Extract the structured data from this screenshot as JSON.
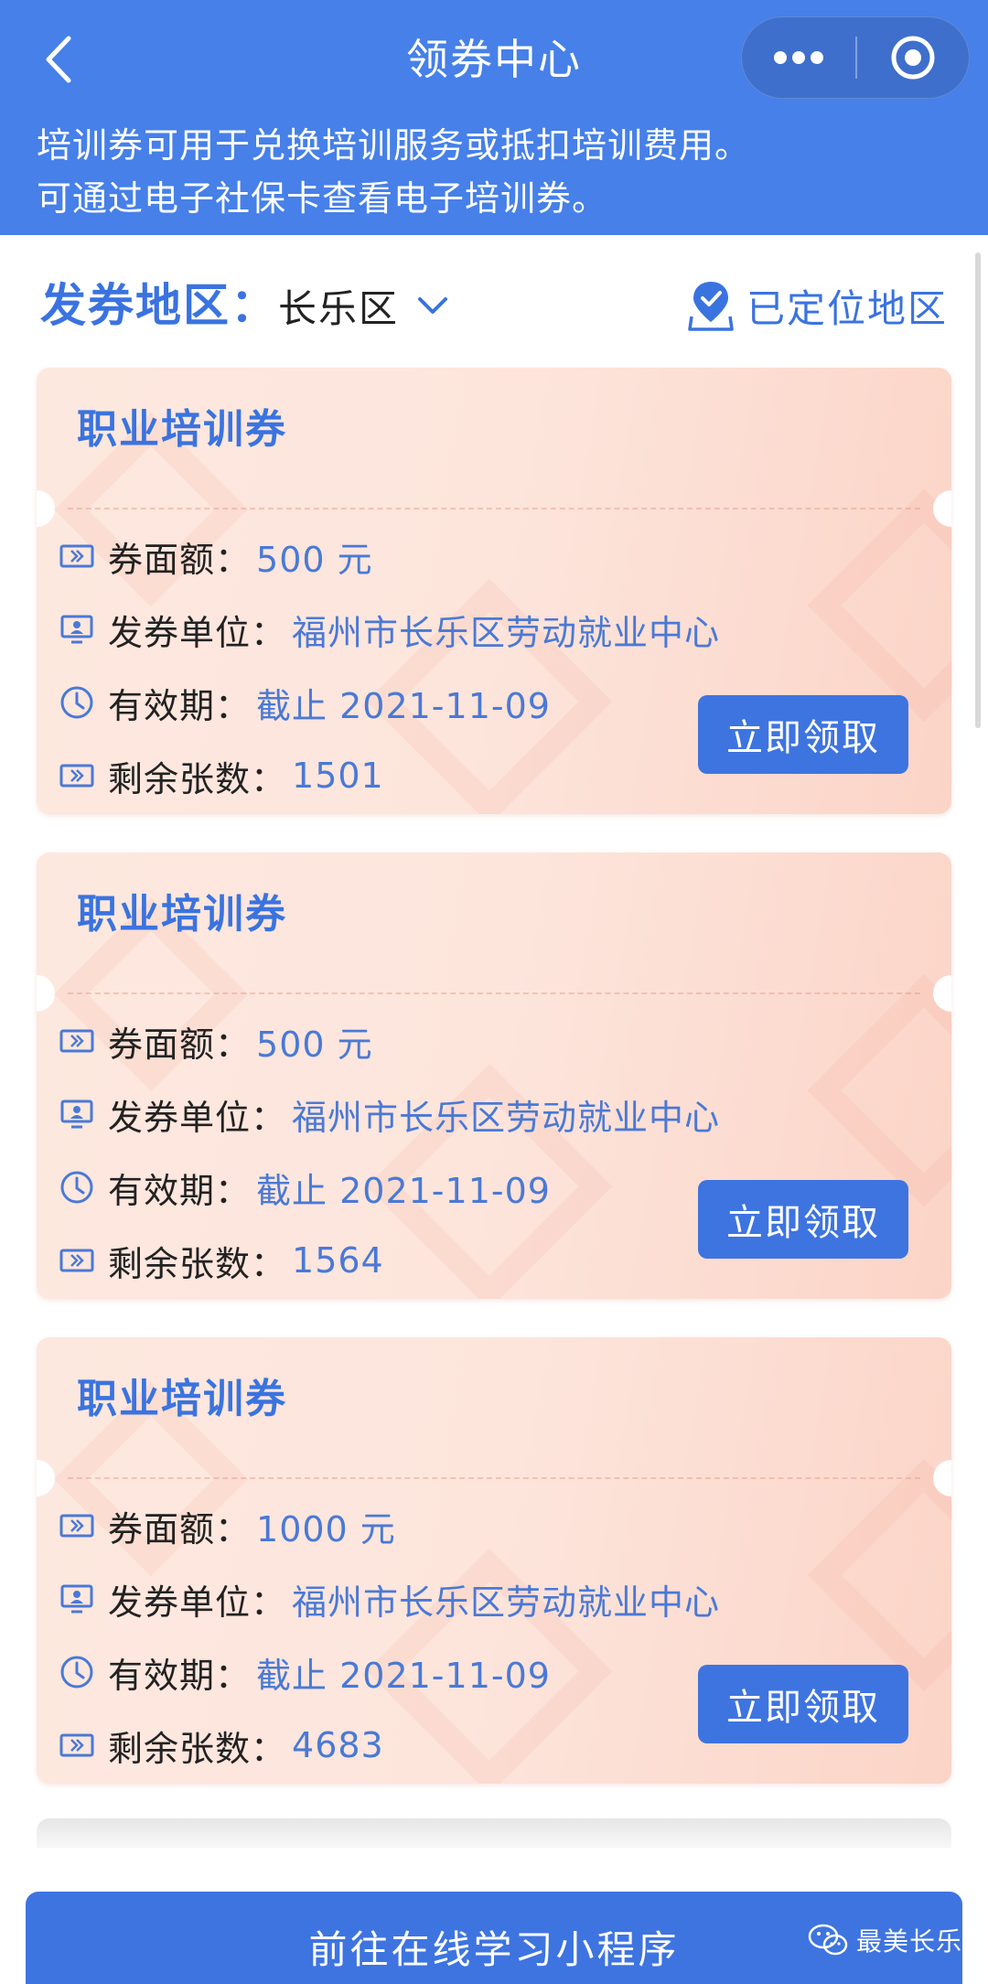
{
  "header": {
    "title": "领券中心",
    "intro_line1": "培训券可用于兑换培训服务或抵扣培训费用。",
    "intro_line2": "可通过电子社保卡查看电子培训券。"
  },
  "region": {
    "label": "发券地区：",
    "selected": "长乐区",
    "located_text": "已定位地区"
  },
  "coupon_fields": {
    "amount_label": "券面额：",
    "issuer_label": "发券单位：",
    "validity_label": "有效期：",
    "remaining_label": "剩余张数："
  },
  "coupons": [
    {
      "title": "职业培训券",
      "amount": "500 元",
      "issuer": "福州市长乐区劳动就业中心",
      "validity": "截止 2021-11-09",
      "remaining": "1501",
      "button": "立即领取"
    },
    {
      "title": "职业培训券",
      "amount": "500 元",
      "issuer": "福州市长乐区劳动就业中心",
      "validity": "截止 2021-11-09",
      "remaining": "1564",
      "button": "立即领取"
    },
    {
      "title": "职业培训券",
      "amount": "1000 元",
      "issuer": "福州市长乐区劳动就业中心",
      "validity": "截止 2021-11-09",
      "remaining": "4683",
      "button": "立即领取"
    }
  ],
  "bottom": {
    "button_label": "前往在线学习小程序",
    "watermark": "最美长乐"
  },
  "icons": {
    "back": "back-chevron-icon",
    "more": "more-dots-icon",
    "close": "target-circle-icon",
    "dropdown": "chevron-down-icon",
    "located": "location-pin-check-icon",
    "amount": "ticket-icon",
    "issuer": "monitor-person-icon",
    "validity": "clock-icon",
    "remaining": "ticket-icon",
    "watermark": "wechat-icon"
  },
  "colors": {
    "primary": "#4680e8",
    "button": "#3e74e0",
    "label_blue": "#3a73e0",
    "value_blue": "#4a79d6",
    "card_bg": "#fde5dc"
  }
}
